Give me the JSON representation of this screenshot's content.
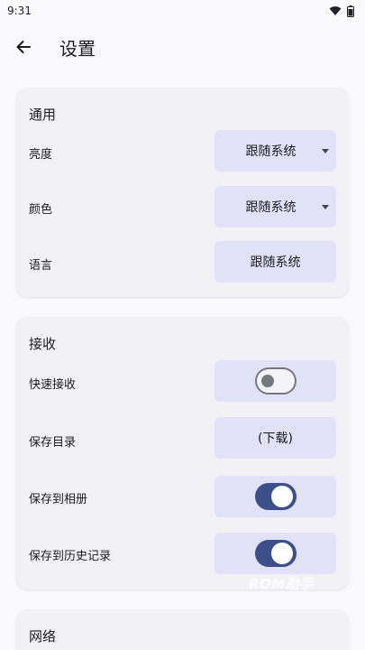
{
  "status_bar": {
    "time": "9:31"
  },
  "app_bar": {
    "title": "设置"
  },
  "sections": {
    "general": {
      "title": "通用",
      "brightness": {
        "label": "亮度",
        "value": "跟随系统"
      },
      "color": {
        "label": "颜色",
        "value": "跟随系统"
      },
      "language": {
        "label": "语言",
        "value": "跟随系统"
      }
    },
    "receive": {
      "title": "接收",
      "quick_receive": {
        "label": "快速接收",
        "on": false
      },
      "save_dir": {
        "label": "保存目录",
        "value": "(下载)"
      },
      "save_to_album": {
        "label": "保存到相册",
        "on": true
      },
      "save_to_history": {
        "label": "保存到历史记录",
        "on": true
      }
    },
    "network": {
      "title": "网络"
    }
  },
  "watermark": "ROM助手",
  "colors": {
    "accent": "#3d4f8a",
    "control_bg": "#e1e2f7",
    "card_bg": "#f2f1f6"
  }
}
